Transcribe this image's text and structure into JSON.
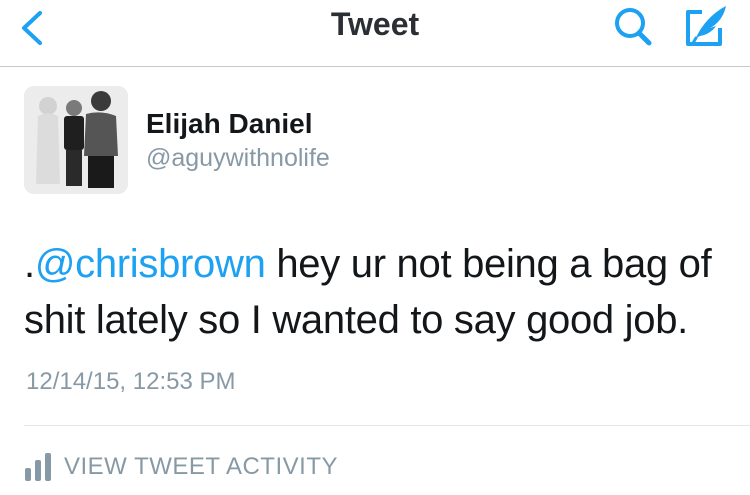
{
  "nav": {
    "title": "Tweet"
  },
  "tweet": {
    "author_name": "Elijah Daniel",
    "author_handle": "@aguywithnolife",
    "text_prefix": ".",
    "mention": "@chrisbrown",
    "text_rest": " hey ur not being a bag of shit lately so I wanted to say good job.",
    "timestamp": "12/14/15, 12:53 PM"
  },
  "actions": {
    "view_activity_label": "VIEW TWEET ACTIVITY"
  },
  "colors": {
    "accent": "#1da1f2",
    "secondary_text": "#8899a6",
    "divider": "#e1e8ed"
  }
}
